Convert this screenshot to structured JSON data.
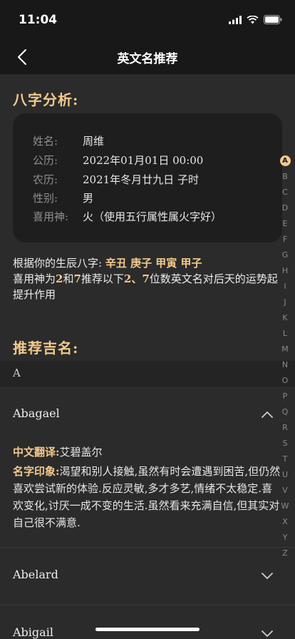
{
  "status": {
    "time": "11:04"
  },
  "nav": {
    "title": "英文名推荐"
  },
  "bazi": {
    "title": "八字分析:",
    "rows": [
      {
        "label": "姓名:",
        "value": "周维"
      },
      {
        "label": "公历:",
        "value": "2022年01月01日 00:00"
      },
      {
        "label": "农历:",
        "value": "2021年冬月廿九日 子时"
      },
      {
        "label": "性别:",
        "value": "男"
      },
      {
        "label": "喜用神:",
        "value": "火（使用五行属性属火字好）"
      }
    ]
  },
  "summary": {
    "prefix": "根据你的生辰八字:",
    "bazi_chars": "辛丑 庚子 甲寅 甲子",
    "line2_a": "喜用神为",
    "num1": "2",
    "and": "和",
    "num2": "7",
    "line2_b": "推荐以下",
    "nums": "2、7",
    "line2_c": "位数英文名对后天的运势起提升作用"
  },
  "recommend": {
    "title": "推荐吉名:",
    "group": "A",
    "names": [
      {
        "name": "Abagael",
        "expanded": true,
        "translation_label": "中文翻译:",
        "translation": "艾碧盖尔",
        "impression_label": "名字印象:",
        "impression": "渴望和别人接触,虽然有时会遭遇到困苦,但仍然喜欢尝试新的体验.反应灵敏,多才多艺,情绪不太稳定.喜欢变化,讨厌一成不变的生活.虽然看来充满自信,但其实对自己很不满意."
      },
      {
        "name": "Abelard",
        "expanded": false
      },
      {
        "name": "Abigail",
        "expanded": false
      }
    ]
  },
  "index": [
    "A",
    "B",
    "C",
    "D",
    "E",
    "F",
    "G",
    "H",
    "I",
    "J",
    "K",
    "L",
    "M",
    "N",
    "O",
    "P",
    "Q",
    "R",
    "S",
    "T",
    "U",
    "V",
    "W",
    "X",
    "Y",
    "Z"
  ],
  "colors": {
    "accent": "#f3c98c",
    "background": "#2b2b2b",
    "card": "#1e1e1e"
  }
}
